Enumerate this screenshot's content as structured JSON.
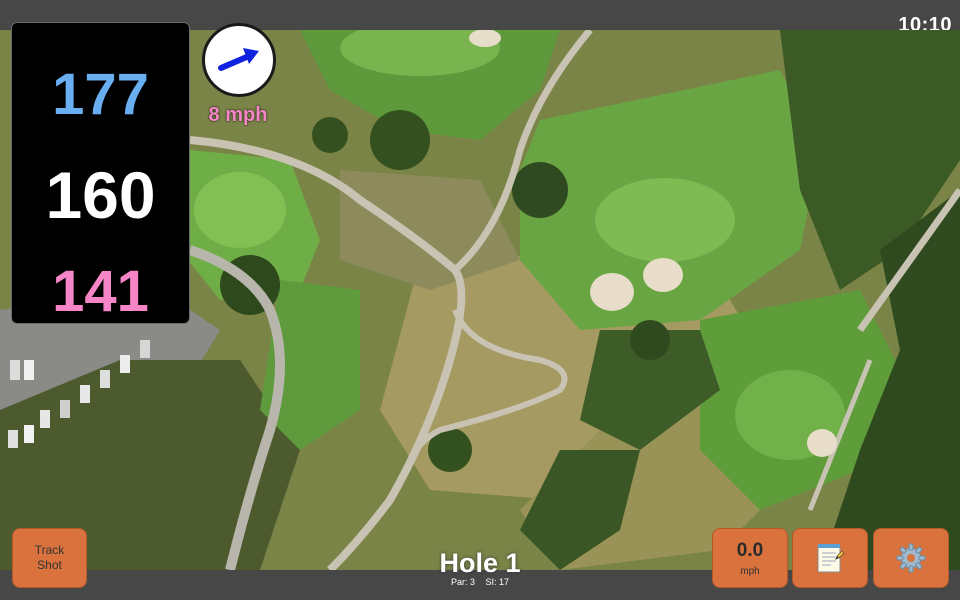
{
  "status": {
    "time": "10:10"
  },
  "distances": {
    "back": "177",
    "middle": "160",
    "front": "141"
  },
  "wind": {
    "speed": "8 mph",
    "icon": "wind-arrow-icon"
  },
  "buttons": {
    "track_shot_line1": "Track",
    "track_shot_line2": "Shot",
    "speed_value": "0.0",
    "speed_unit": "mph",
    "notes_icon": "notepad-icon",
    "settings_icon": "gear-icon"
  },
  "hole": {
    "title": "Hole 1",
    "par": "Par: 3",
    "si": "SI: 17"
  },
  "colors": {
    "back_distance": "#6aaef2",
    "middle_distance": "#ffffff",
    "front_distance": "#f585c7",
    "button_orange": "#d9723d",
    "bars": "#474747"
  }
}
